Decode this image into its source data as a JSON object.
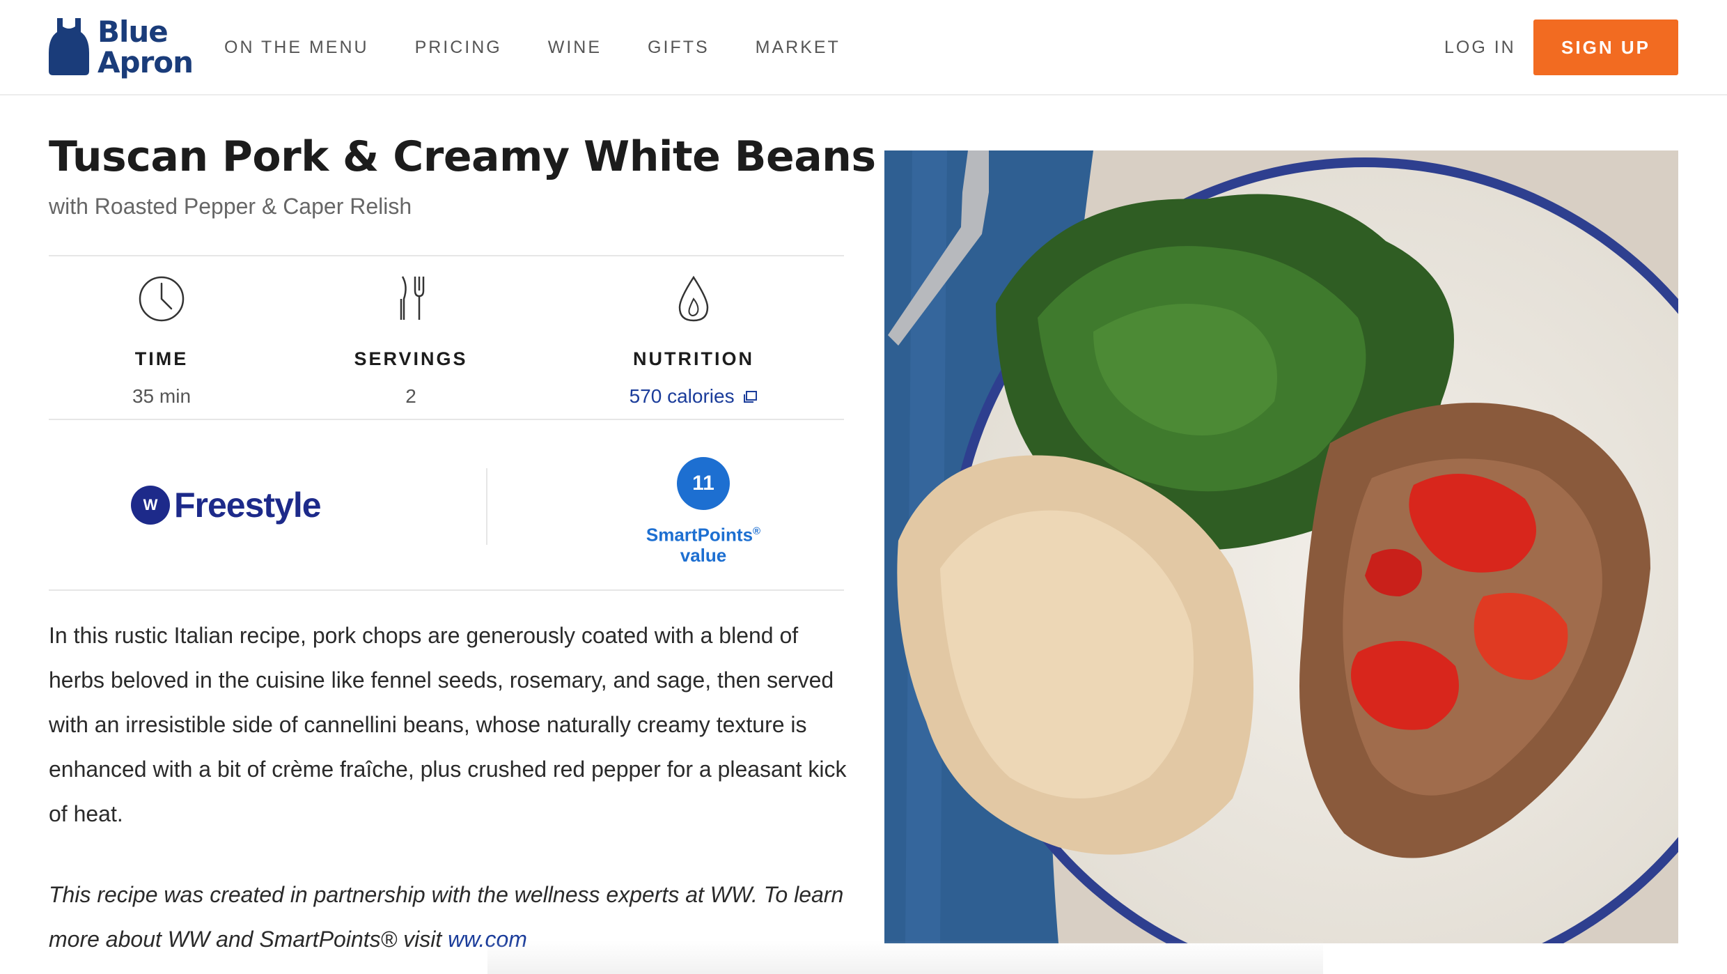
{
  "brand": {
    "line1": "Blue",
    "line2": "Apron"
  },
  "nav": [
    {
      "label": "ON THE MENU"
    },
    {
      "label": "PRICING"
    },
    {
      "label": "WINE"
    },
    {
      "label": "GIFTS"
    },
    {
      "label": "MARKET"
    }
  ],
  "auth": {
    "login": "LOG IN",
    "signup": "SIGN UP"
  },
  "recipe": {
    "title": "Tuscan Pork & Creamy White Beans",
    "subtitle": "with Roasted Pepper & Caper Relish",
    "stats": {
      "time": {
        "label": "TIME",
        "value": "35 min",
        "icon": "clock-icon"
      },
      "servings": {
        "label": "SERVINGS",
        "value": "2",
        "icon": "utensils-icon"
      },
      "nutrition": {
        "label": "NUTRITION",
        "value": "570 calories",
        "icon": "drop-icon"
      }
    },
    "ww": {
      "badge": "W",
      "brand": "Freestyle"
    },
    "smartpoints": {
      "value": "11",
      "line1": "SmartPoints",
      "reg": "®",
      "line2": "value"
    },
    "description": "In this rustic Italian recipe, pork chops are generously coated with a blend of herbs beloved in the cuisine like fennel seeds, rosemary, and sage, then served with an irresistible side of cannellini beans, whose naturally creamy texture is enhanced with a bit of crème fraîche, plus crushed red pepper for a pleasant kick of heat.",
    "note": {
      "text": "This recipe was created in partnership with the wellness experts at WW. To learn more about WW and SmartPoints® visit ",
      "link": "ww.com"
    }
  },
  "colors": {
    "accent": "#f26b21",
    "brand": "#1a3c7a",
    "ww": "#1d2a8a",
    "smartpoints": "#1d6fd1"
  }
}
